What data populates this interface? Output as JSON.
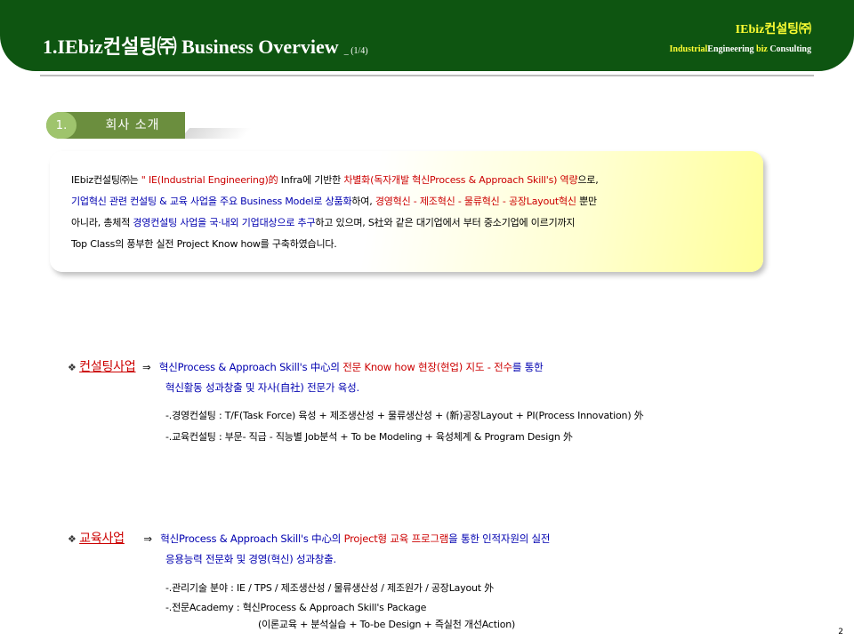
{
  "header": {
    "title_main": "1.IEbiz컨설팅㈜ Business Overview",
    "title_sub": "_ (1/4)",
    "brand": "IEbiz컨설팅㈜",
    "tagline": [
      "Industrial",
      "Engineering",
      " biz",
      " Consulting"
    ]
  },
  "section": {
    "number": "1.",
    "label": "회사 소개"
  },
  "intro": {
    "lines": [
      [
        {
          "text": "IEbiz컨설팅㈜는 ",
          "color": "black"
        },
        {
          "text": "\" IE(Industrial Engineering)的",
          "color": "red"
        },
        {
          "text": " Infra에 기반한 ",
          "color": "black"
        },
        {
          "text": "차별화(독자개발 혁신Process & Approach Skill's) 역량",
          "color": "red"
        },
        {
          "text": "으로,",
          "color": "black"
        }
      ],
      [
        {
          "text": "기업혁신 관련 컨설팅 & 교육 사업을 주요 Business Model로 상품화",
          "color": "blue"
        },
        {
          "text": "하여, ",
          "color": "black"
        },
        {
          "text": "경영혁신 - 제조혁신 - 물류혁신 - 공장Layout혁신",
          "color": "red"
        },
        {
          "text": " 뿐만",
          "color": "black"
        }
      ],
      [
        {
          "text": "아니라, 총체적 ",
          "color": "black"
        },
        {
          "text": "경영컨설팅 사업을 국·내외 기업대상으로 추구",
          "color": "blue"
        },
        {
          "text": "하고 있으며, S社와 같은 대기업에서 부터 중소기업에 이르기까지",
          "color": "black"
        }
      ],
      [
        {
          "text": "Top Class의 풍부한 실전 Project Know how를 구축하였습니다.",
          "color": "black"
        }
      ]
    ]
  },
  "items": [
    {
      "title": "컨설팅사업",
      "arrow": "⇒",
      "line1": [
        {
          "text": "혁신Process & Approach Skill's 中心의 ",
          "color": "blue"
        },
        {
          "text": "전문 Know how 현장(현업) 지도 - 전수",
          "color": "red"
        },
        {
          "text": "를 통한",
          "color": "blue"
        }
      ],
      "line2": "혁신활동 성과창출 및 자사(自社) 전문가 육성.",
      "details": [
        "-.경영컨설팅 : T/F(Task Force) 육성 + 제조생산성 + 물류생산성 + (新)공장Layout + PI(Process Innovation) 外",
        "-.교육컨설팅 : 부문- 직급 - 직능별 Job분석 + To be Modeling + 육성체계 & Program Design 外"
      ]
    },
    {
      "title": "교육사업",
      "arrow": "⇒",
      "line1": [
        {
          "text": "혁신Process & Approach Skill's 中心의 ",
          "color": "blue"
        },
        {
          "text": "Project형 교육 프로그램",
          "color": "red"
        },
        {
          "text": "을 통한 인적자원의 실전",
          "color": "blue"
        }
      ],
      "line2": "응용능력 전문화 및 경영(혁신) 성과창출.",
      "details": [
        "-.관리기술 분야 : IE / TPS / 제조생산성 / 물류생산성 / 제조원가 / 공장Layout 外",
        "-.전문Academy : 혁신Process & Approach Skill's Package",
        "(이론교육 + 분석실습 + To-be Design + 즉실천 개선Action)"
      ]
    }
  ],
  "page_number": "2",
  "colors": {
    "header_green": "#0e5511",
    "brand_yellow": "#ffff33",
    "red": "#cc0000",
    "blue": "#0000b0"
  }
}
